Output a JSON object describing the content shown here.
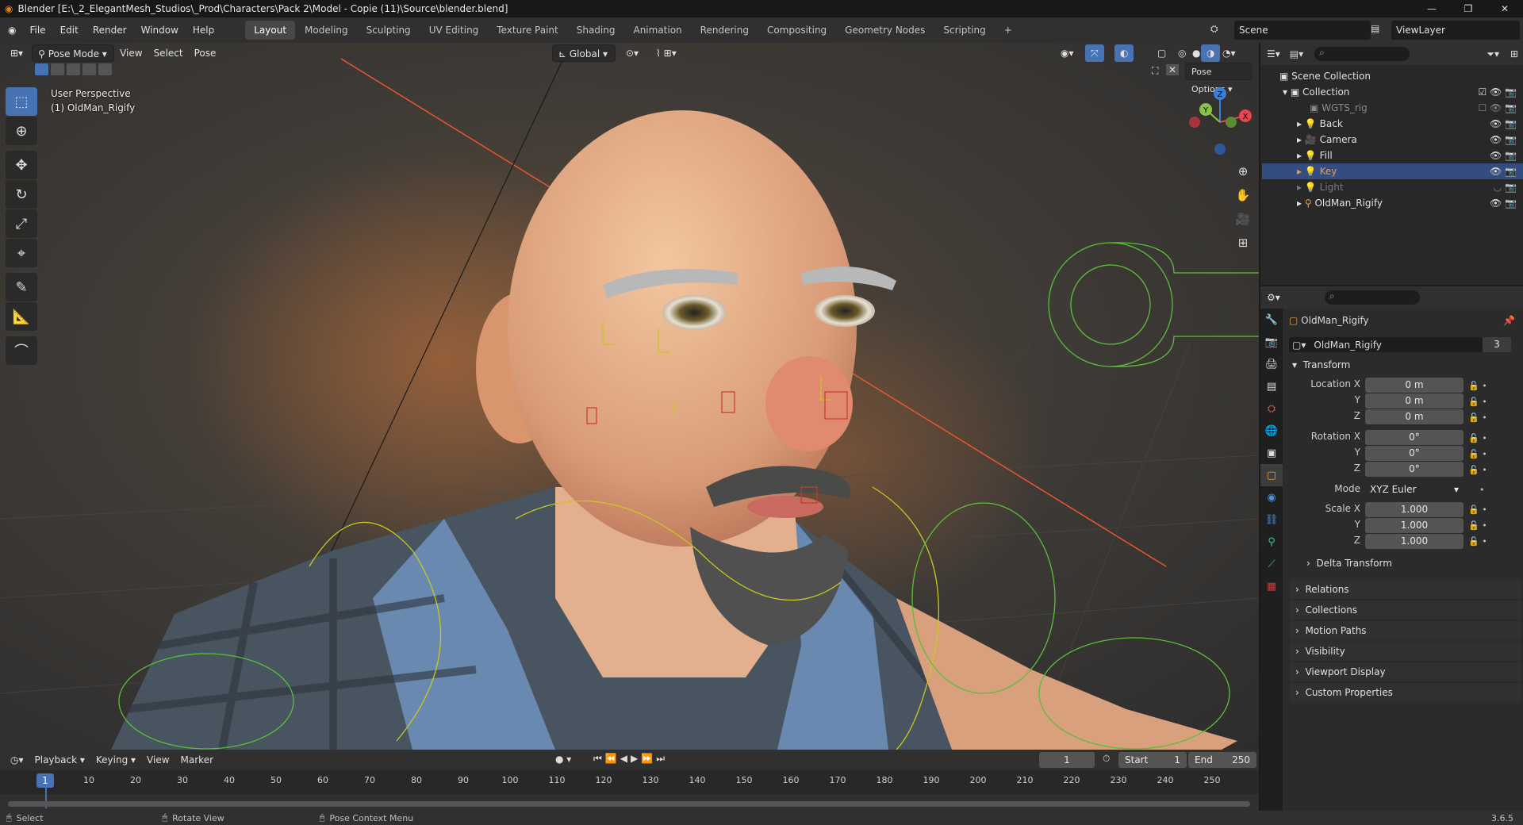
{
  "title": "Blender [E:\\_2_ElegantMesh_Studios\\_Prod\\Characters\\Pack 2\\Model - Copie (11)\\Source\\blender.blend]",
  "menu": [
    "File",
    "Edit",
    "Render",
    "Window",
    "Help"
  ],
  "workspaces": [
    "Layout",
    "Modeling",
    "Sculpting",
    "UV Editing",
    "Texture Paint",
    "Shading",
    "Animation",
    "Rendering",
    "Compositing",
    "Geometry Nodes",
    "Scripting"
  ],
  "scene": "Scene",
  "view_layer": "ViewLayer",
  "viewport": {
    "mode": "Pose Mode",
    "menus": [
      "View",
      "Select",
      "Pose"
    ],
    "orientation": "Global",
    "pose_options": "Pose Options",
    "info_line1": "User Perspective",
    "info_line2": "(1) OldMan_Rigify"
  },
  "outliner": {
    "root": "Scene Collection",
    "items": [
      {
        "name": "Collection"
      },
      {
        "name": "WGTS_rig"
      },
      {
        "name": "Back"
      },
      {
        "name": "Camera"
      },
      {
        "name": "Fill"
      },
      {
        "name": "Key"
      },
      {
        "name": "Light"
      },
      {
        "name": "OldMan_Rigify"
      }
    ]
  },
  "properties": {
    "object_name": "OldMan_Rigify",
    "data_name": "OldMan_Rigify",
    "users": "3",
    "transform_title": "Transform",
    "location_x_label": "Location X",
    "rotation_x_label": "Rotation X",
    "scale_x_label": "Scale X",
    "y_label": "Y",
    "z_label": "Z",
    "location": [
      "0 m",
      "0 m",
      "0 m"
    ],
    "rotation": [
      "0°",
      "0°",
      "0°"
    ],
    "mode_label": "Mode",
    "mode_value": "XYZ Euler",
    "scale": [
      "1.000",
      "1.000",
      "1.000"
    ],
    "delta": "Delta Transform",
    "panels": [
      "Relations",
      "Collections",
      "Motion Paths",
      "Visibility",
      "Viewport Display",
      "Custom Properties"
    ]
  },
  "timeline": {
    "menus": [
      "Playback",
      "Keying",
      "View",
      "Marker"
    ],
    "current_frame": "1",
    "start_label": "Start",
    "start": "1",
    "end_label": "End",
    "end": "250",
    "ticks": [
      "10",
      "20",
      "30",
      "40",
      "50",
      "60",
      "70",
      "80",
      "90",
      "100",
      "110",
      "120",
      "130",
      "140",
      "150",
      "160",
      "170",
      "180",
      "190",
      "200",
      "210",
      "220",
      "230",
      "240",
      "250"
    ]
  },
  "status": {
    "select": "Select",
    "rotate": "Rotate View",
    "context": "Pose Context Menu",
    "version": "3.6.5"
  },
  "colors": {
    "accent": "#4772b3",
    "x_axis": "#e8454f",
    "y_axis": "#8bc34a",
    "z_axis": "#3d7fd6",
    "selection": "#334d80"
  }
}
